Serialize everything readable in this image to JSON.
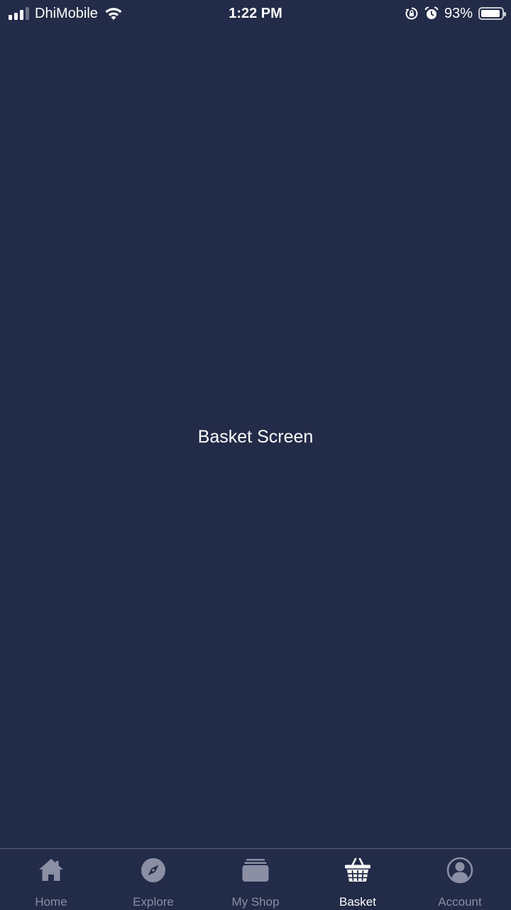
{
  "status_bar": {
    "carrier": "DhiMobile",
    "time": "1:22 PM",
    "battery_percent": "93%",
    "battery_level": 0.93,
    "icons": [
      "signal-icon",
      "wifi-icon",
      "rotation-lock-icon",
      "alarm-icon",
      "battery-icon"
    ]
  },
  "main": {
    "title": "Basket Screen"
  },
  "tab_bar": {
    "active_tab": "Basket",
    "active_color": "#ffffff",
    "inactive_color": "#8a8fa3",
    "tabs": [
      {
        "label": "Home",
        "icon": "home-icon"
      },
      {
        "label": "Explore",
        "icon": "compass-icon"
      },
      {
        "label": "My Shop",
        "icon": "shop-icon"
      },
      {
        "label": "Basket",
        "icon": "basket-icon"
      },
      {
        "label": "Account",
        "icon": "account-icon"
      }
    ]
  },
  "colors": {
    "background": "#222b48",
    "text": "#ffffff"
  }
}
